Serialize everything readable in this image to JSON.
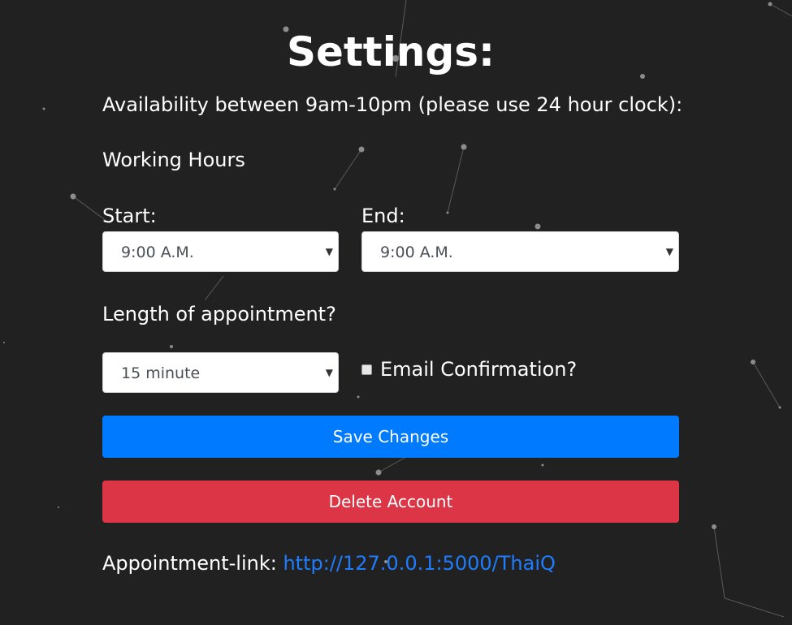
{
  "page": {
    "title": "Settings:",
    "availability_note": "Availability between 9am-10pm (please use 24 hour clock):",
    "working_hours_heading": "Working Hours"
  },
  "working_hours": {
    "start_label": "Start:",
    "start_value": "9:00 A.M.",
    "end_label": "End:",
    "end_value": "9:00 A.M."
  },
  "appointment": {
    "length_label": "Length of appointment?",
    "length_value": "15 minute",
    "email_confirmation_label": "Email Confirmation?",
    "email_confirmation_checked": false
  },
  "actions": {
    "save_label": "Save Changes",
    "delete_label": "Delete Account"
  },
  "footer": {
    "link_label": "Appointment-link:",
    "link_url": "http://127.0.0.1:5000/ThaiQ"
  },
  "colors": {
    "background": "#222121",
    "save_button": "#007bff",
    "delete_button": "#dc3545",
    "link": "#1e7dff"
  }
}
